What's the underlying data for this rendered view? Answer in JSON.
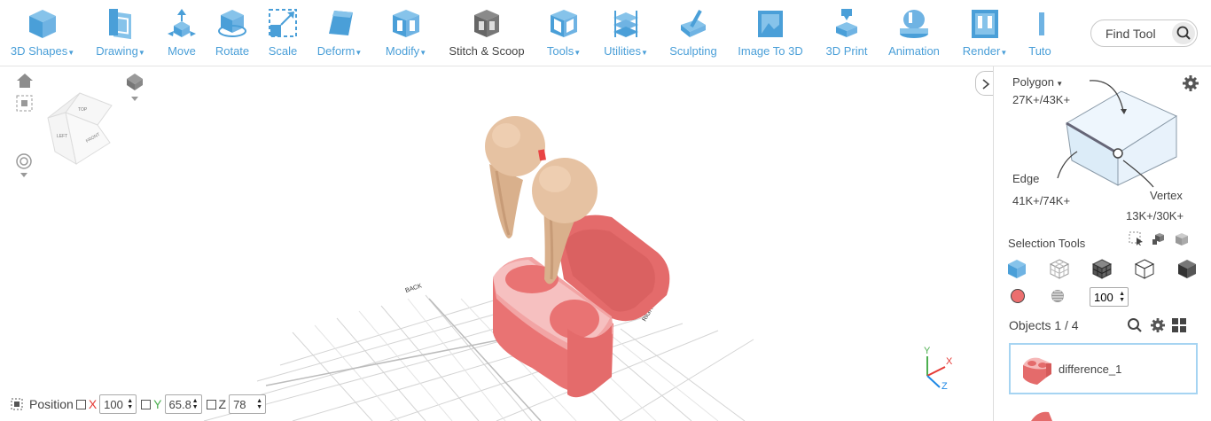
{
  "toolbar": {
    "items": [
      {
        "label": "3D Shapes",
        "has_menu": true,
        "icon": "cube-icon"
      },
      {
        "label": "Drawing",
        "has_menu": true,
        "icon": "drawing-icon"
      },
      {
        "label": "Move",
        "has_menu": false,
        "icon": "move-icon"
      },
      {
        "label": "Rotate",
        "has_menu": false,
        "icon": "rotate-icon"
      },
      {
        "label": "Scale",
        "has_menu": false,
        "icon": "scale-icon"
      },
      {
        "label": "Deform",
        "has_menu": true,
        "icon": "deform-icon"
      },
      {
        "label": "Modify",
        "has_menu": true,
        "icon": "modify-icon"
      },
      {
        "label": "Stitch & Scoop",
        "has_menu": false,
        "icon": "stitch-scoop-icon"
      },
      {
        "label": "Tools",
        "has_menu": true,
        "icon": "tools-icon"
      },
      {
        "label": "Utilities",
        "has_menu": true,
        "icon": "utilities-icon"
      },
      {
        "label": "Sculpting",
        "has_menu": false,
        "icon": "sculpting-icon"
      },
      {
        "label": "Image To 3D",
        "has_menu": false,
        "icon": "image-to-3d-icon"
      },
      {
        "label": "3D Print",
        "has_menu": false,
        "icon": "3d-print-icon"
      },
      {
        "label": "Animation",
        "has_menu": false,
        "icon": "animation-icon"
      },
      {
        "label": "Render",
        "has_menu": true,
        "icon": "render-icon"
      },
      {
        "label": "Tuto",
        "has_menu": false,
        "icon": "tutorial-icon"
      }
    ],
    "find_tool": "Find Tool",
    "accent": "#4a9fd8"
  },
  "viewport": {
    "view_cube_faces": [
      "TOP",
      "LEFT",
      "FRONT"
    ],
    "grid_label_back": "BACK",
    "grid_label_right": "RIGHT",
    "axes": {
      "x": "X",
      "y": "Y",
      "z": "Z"
    }
  },
  "position_bar": {
    "label": "Position",
    "x_label": "X",
    "x_value": "100",
    "y_label": "Y",
    "y_value": "65.8",
    "z_label": "Z",
    "z_value": "78"
  },
  "panel": {
    "polygon_label": "Polygon",
    "polygon_count": "27K+/43K+",
    "edge_label": "Edge",
    "edge_count": "41K+/74K+",
    "vertex_label": "Vertex",
    "vertex_count": "13K+/30K+",
    "selection_tools_label": "Selection Tools",
    "opacity_value": "100",
    "objects_label": "Objects 1 / 4",
    "objects": [
      {
        "name": "difference_1"
      }
    ],
    "selection_color": "#ec6f6f"
  }
}
